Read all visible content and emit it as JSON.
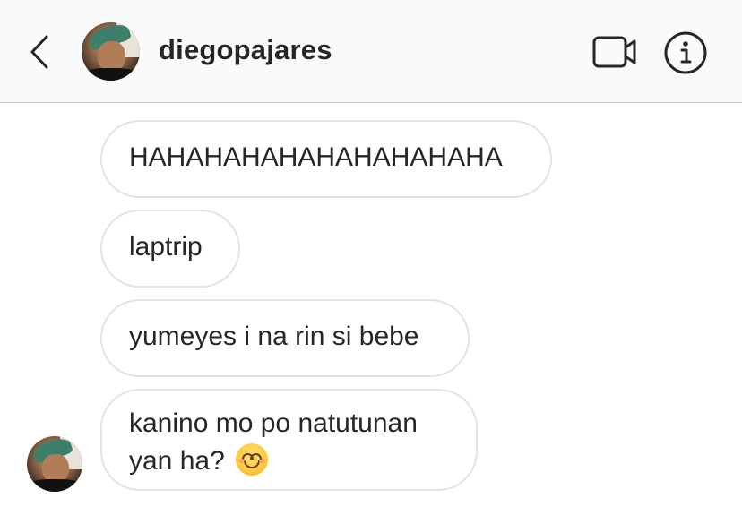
{
  "header": {
    "username": "diegopajares",
    "icons": {
      "back": "chevron-left-icon",
      "video": "video-call-icon",
      "info": "info-icon"
    }
  },
  "messages": [
    {
      "text": "HAHAHAHAHAHAHAHAHAHA"
    },
    {
      "text": "laptrip"
    },
    {
      "text": "yumeyes i na rin si bebe"
    },
    {
      "text_line1": "kanino mo po natutunan",
      "text_line2": "yan ha?",
      "emoji": "smiling-face-with-smiling-eyes"
    }
  ],
  "colors": {
    "header_bg": "#fafafa",
    "bubble_border": "#e3e3e3",
    "text": "#262626"
  }
}
